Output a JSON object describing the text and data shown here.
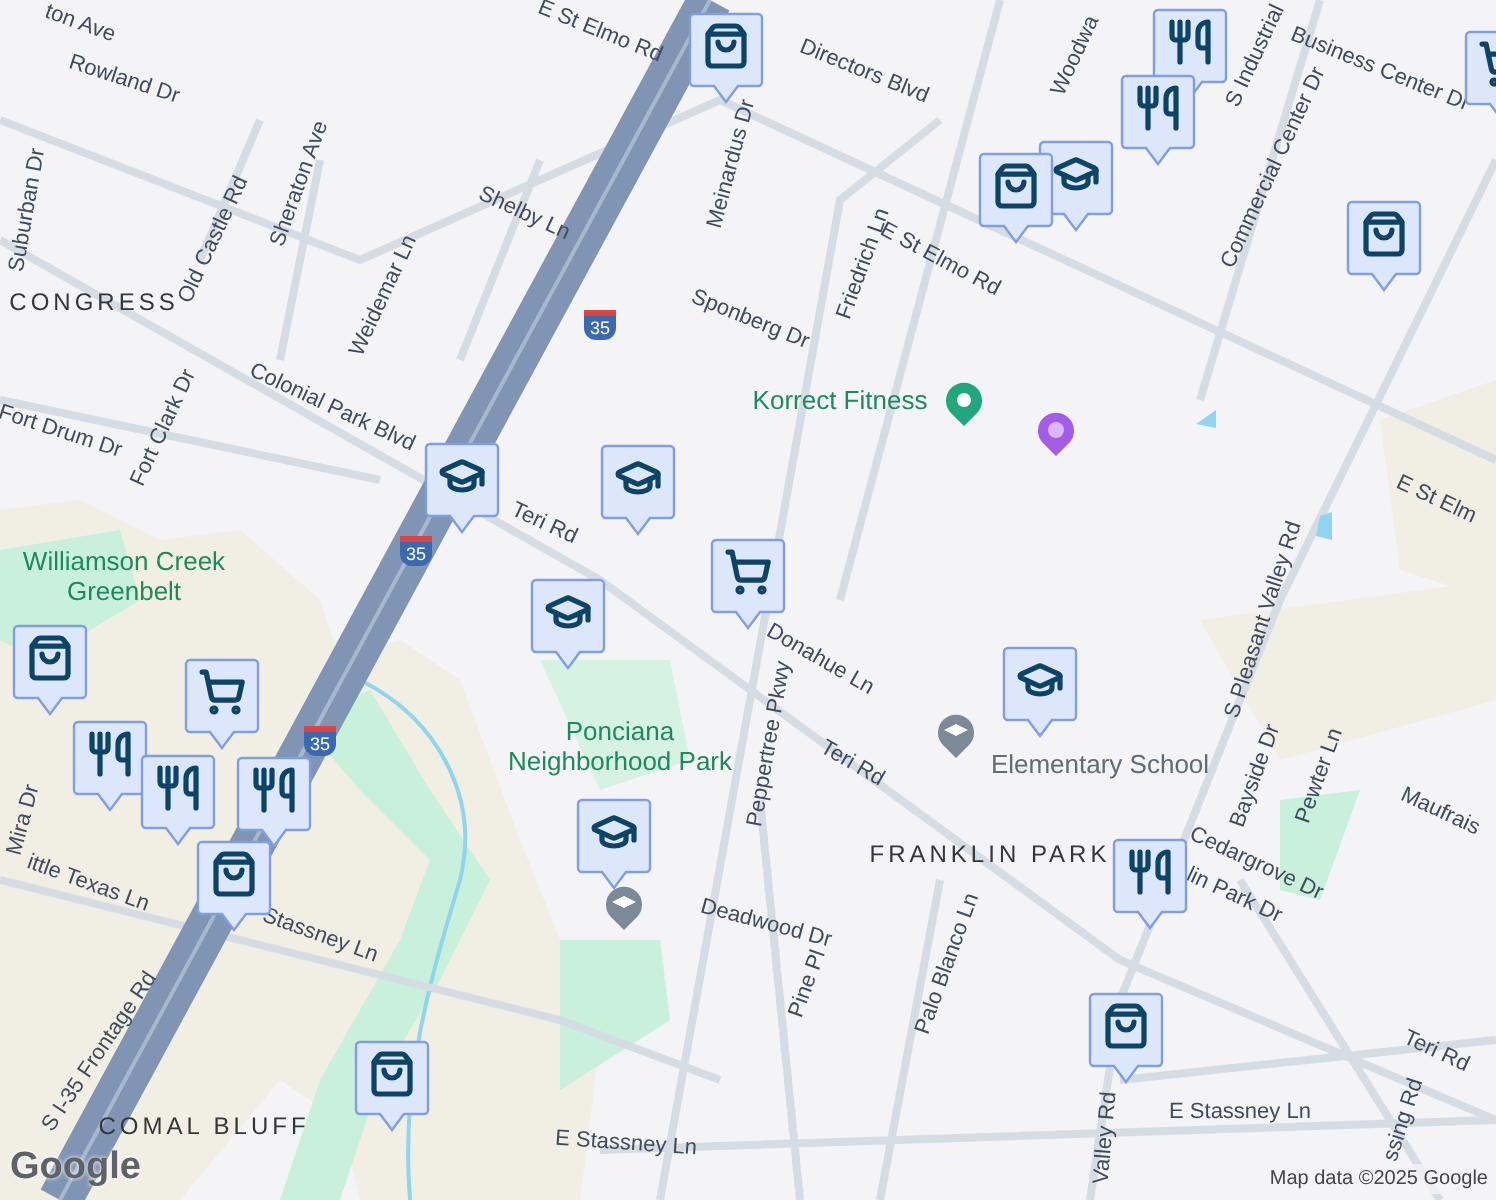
{
  "labels": [
    {
      "text": "ton Ave",
      "kind": "street"
    },
    {
      "text": "Rowland Dr",
      "kind": "street"
    },
    {
      "text": "E St Elmo Rd",
      "kind": "street"
    },
    {
      "text": "Directors Blvd",
      "kind": "street"
    },
    {
      "text": "Suburban Dr",
      "kind": "street"
    },
    {
      "text": "Old Castle Rd",
      "kind": "street"
    },
    {
      "text": "Sheraton Ave",
      "kind": "street"
    },
    {
      "text": "Shelby Ln",
      "kind": "street"
    },
    {
      "text": "Meinardus Dr",
      "kind": "street"
    },
    {
      "text": "Friedrich Ln",
      "kind": "street"
    },
    {
      "text": "Woodwa",
      "kind": "street"
    },
    {
      "text": "S Industrial",
      "kind": "street"
    },
    {
      "text": "Business Center Dr",
      "kind": "street"
    },
    {
      "text": "Commercial Center Dr",
      "kind": "street"
    },
    {
      "text": "E St Elmo Rd",
      "kind": "street"
    },
    {
      "text": "Sponberg Dr",
      "kind": "street"
    },
    {
      "text": "CONGRESS",
      "kind": "area"
    },
    {
      "text": "Weidemar Ln",
      "kind": "street"
    },
    {
      "text": "Fort Clark Dr",
      "kind": "street"
    },
    {
      "text": "Fort Drum Dr",
      "kind": "street"
    },
    {
      "text": "Colonial Park Blvd",
      "kind": "street"
    },
    {
      "text": "Teri Rd",
      "kind": "street"
    },
    {
      "text": "E St Elm",
      "kind": "street"
    },
    {
      "text": "S Pleasant Valley Rd",
      "kind": "street"
    },
    {
      "text": "Korrect Fitness",
      "kind": "poi"
    },
    {
      "text": "Donahue Ln",
      "kind": "street"
    },
    {
      "text": "Peppertree Pkwy",
      "kind": "street"
    },
    {
      "text": "Teri Rd",
      "kind": "street"
    },
    {
      "text": "Ponciana Neighborhood Park",
      "kind": "poi"
    },
    {
      "text": "Elementary School",
      "kind": "school"
    },
    {
      "text": "Williamson Creek Greenbelt",
      "kind": "poi"
    },
    {
      "text": "Deadwood Dr",
      "kind": "street"
    },
    {
      "text": "Pine Pl",
      "kind": "street"
    },
    {
      "text": "Palo Blanco Ln",
      "kind": "street"
    },
    {
      "text": "FRANKLIN PARK",
      "kind": "area"
    },
    {
      "text": "Bayside Dr",
      "kind": "street"
    },
    {
      "text": "Pewter Ln",
      "kind": "street"
    },
    {
      "text": "Cedargrove Dr",
      "kind": "street"
    },
    {
      "text": "lin Park Dr",
      "kind": "street"
    },
    {
      "text": "Maufrais",
      "kind": "street"
    },
    {
      "text": "Teri Rd",
      "kind": "street"
    },
    {
      "text": "ssing Rd",
      "kind": "street"
    },
    {
      "text": "E Stassney Ln",
      "kind": "street"
    },
    {
      "text": "Valley Rd",
      "kind": "street"
    },
    {
      "text": "E Stassney Ln",
      "kind": "street"
    },
    {
      "text": "Stassney Ln",
      "kind": "street"
    },
    {
      "text": "ittle Texas Ln",
      "kind": "street"
    },
    {
      "text": "Mira Dr",
      "kind": "street"
    },
    {
      "text": "S I-35 Frontage Rd",
      "kind": "street"
    },
    {
      "text": "COMAL BLUFF",
      "kind": "area"
    }
  ],
  "markers": [
    {
      "kind": "shopping"
    },
    {
      "kind": "restaurant"
    },
    {
      "kind": "restaurant"
    },
    {
      "kind": "school"
    },
    {
      "kind": "shopping"
    },
    {
      "kind": "grocery"
    },
    {
      "kind": "shopping"
    },
    {
      "kind": "school"
    },
    {
      "kind": "school"
    },
    {
      "kind": "grocery"
    },
    {
      "kind": "school"
    },
    {
      "kind": "shopping"
    },
    {
      "kind": "grocery"
    },
    {
      "kind": "restaurant"
    },
    {
      "kind": "restaurant"
    },
    {
      "kind": "restaurant"
    },
    {
      "kind": "shopping"
    },
    {
      "kind": "school"
    },
    {
      "kind": "school"
    },
    {
      "kind": "restaurant"
    },
    {
      "kind": "shopping"
    },
    {
      "kind": "shopping"
    }
  ],
  "highway_shields": [
    "35",
    "35",
    "35"
  ],
  "logo": "Google",
  "attribution": "Map data ©2025 Google"
}
